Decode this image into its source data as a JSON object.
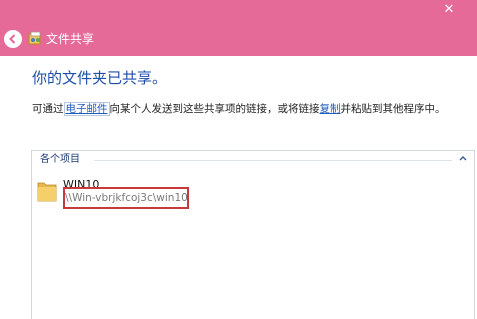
{
  "window": {
    "title": "文件共享",
    "close_label": "✕",
    "back_icon": "back-arrow-icon",
    "app_icon": "file-share-icon",
    "accent": "#e66a98"
  },
  "main": {
    "heading": "你的文件夹已共享。",
    "description": {
      "part1": "可通过",
      "email_link": "电子邮件",
      "part2": "向某个人发送到这些共享项的链接，或将链接",
      "copy_link": "复制",
      "part3": "并粘贴到其他程序中。"
    }
  },
  "list": {
    "group_label": "各个项目",
    "collapse_icon": "chevron-up-icon",
    "items": [
      {
        "name": "WIN10",
        "path": "\\\\Win-vbrjkfcoj3c\\win10",
        "icon": "folder-icon"
      }
    ]
  }
}
